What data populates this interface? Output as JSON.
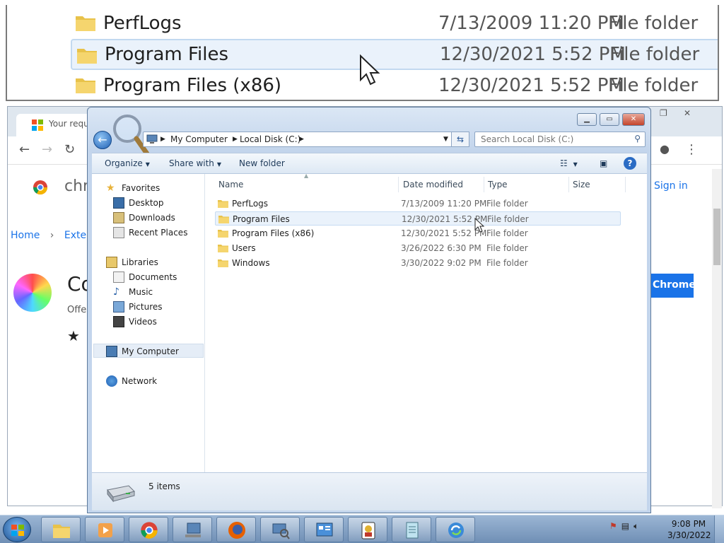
{
  "zoom": {
    "rows": [
      {
        "name": "PerfLogs",
        "date": "7/13/2009 11:20 PM",
        "type": "File folder"
      },
      {
        "name": "Program Files",
        "date": "12/30/2021 5:52 PM",
        "type": "File folder"
      },
      {
        "name": "Program Files (x86)",
        "date": "12/30/2021 5:52 PM",
        "type": "File folder"
      }
    ]
  },
  "chrome": {
    "tab_title": "Your request",
    "breadcrumb_home": "Home",
    "breadcrumb_next": "Exten",
    "logo_text": "chr",
    "signin": "Sign in",
    "ext_title": "Co",
    "offered": "Offe",
    "stars": "★",
    "add_button": "Chrome"
  },
  "explorer": {
    "address": {
      "root": "My Computer",
      "current": "Local Disk (C:)"
    },
    "search_placeholder": "Search Local Disk (C:)",
    "commands": {
      "organize": "Organize",
      "share": "Share with",
      "new_folder": "New folder"
    },
    "nav": {
      "favorites": "Favorites",
      "favorite_items": [
        "Desktop",
        "Downloads",
        "Recent Places"
      ],
      "libraries": "Libraries",
      "library_items": [
        "Documents",
        "Music",
        "Pictures",
        "Videos"
      ],
      "computer": "My Computer",
      "network": "Network"
    },
    "columns": {
      "name": "Name",
      "date": "Date modified",
      "type": "Type",
      "size": "Size"
    },
    "files": [
      {
        "name": "PerfLogs",
        "date": "7/13/2009 11:20 PM",
        "type": "File folder"
      },
      {
        "name": "Program Files",
        "date": "12/30/2021 5:52 PM",
        "type": "File folder"
      },
      {
        "name": "Program Files (x86)",
        "date": "12/30/2021 5:52 PM",
        "type": "File folder"
      },
      {
        "name": "Users",
        "date": "3/26/2022 6:30 PM",
        "type": "File folder"
      },
      {
        "name": "Windows",
        "date": "3/30/2022 9:02 PM",
        "type": "File folder"
      }
    ],
    "status_count": "5 items"
  },
  "taskbar": {
    "clock_time": "9:08 PM",
    "clock_date": "3/30/2022",
    "apps": [
      "explorer-icon",
      "media-player-icon",
      "chrome-icon",
      "network-computer-icon",
      "firefox-icon",
      "search-computer-icon",
      "control-panel-icon",
      "solitaire-icon",
      "notepad-icon",
      "windows-update-icon"
    ]
  }
}
